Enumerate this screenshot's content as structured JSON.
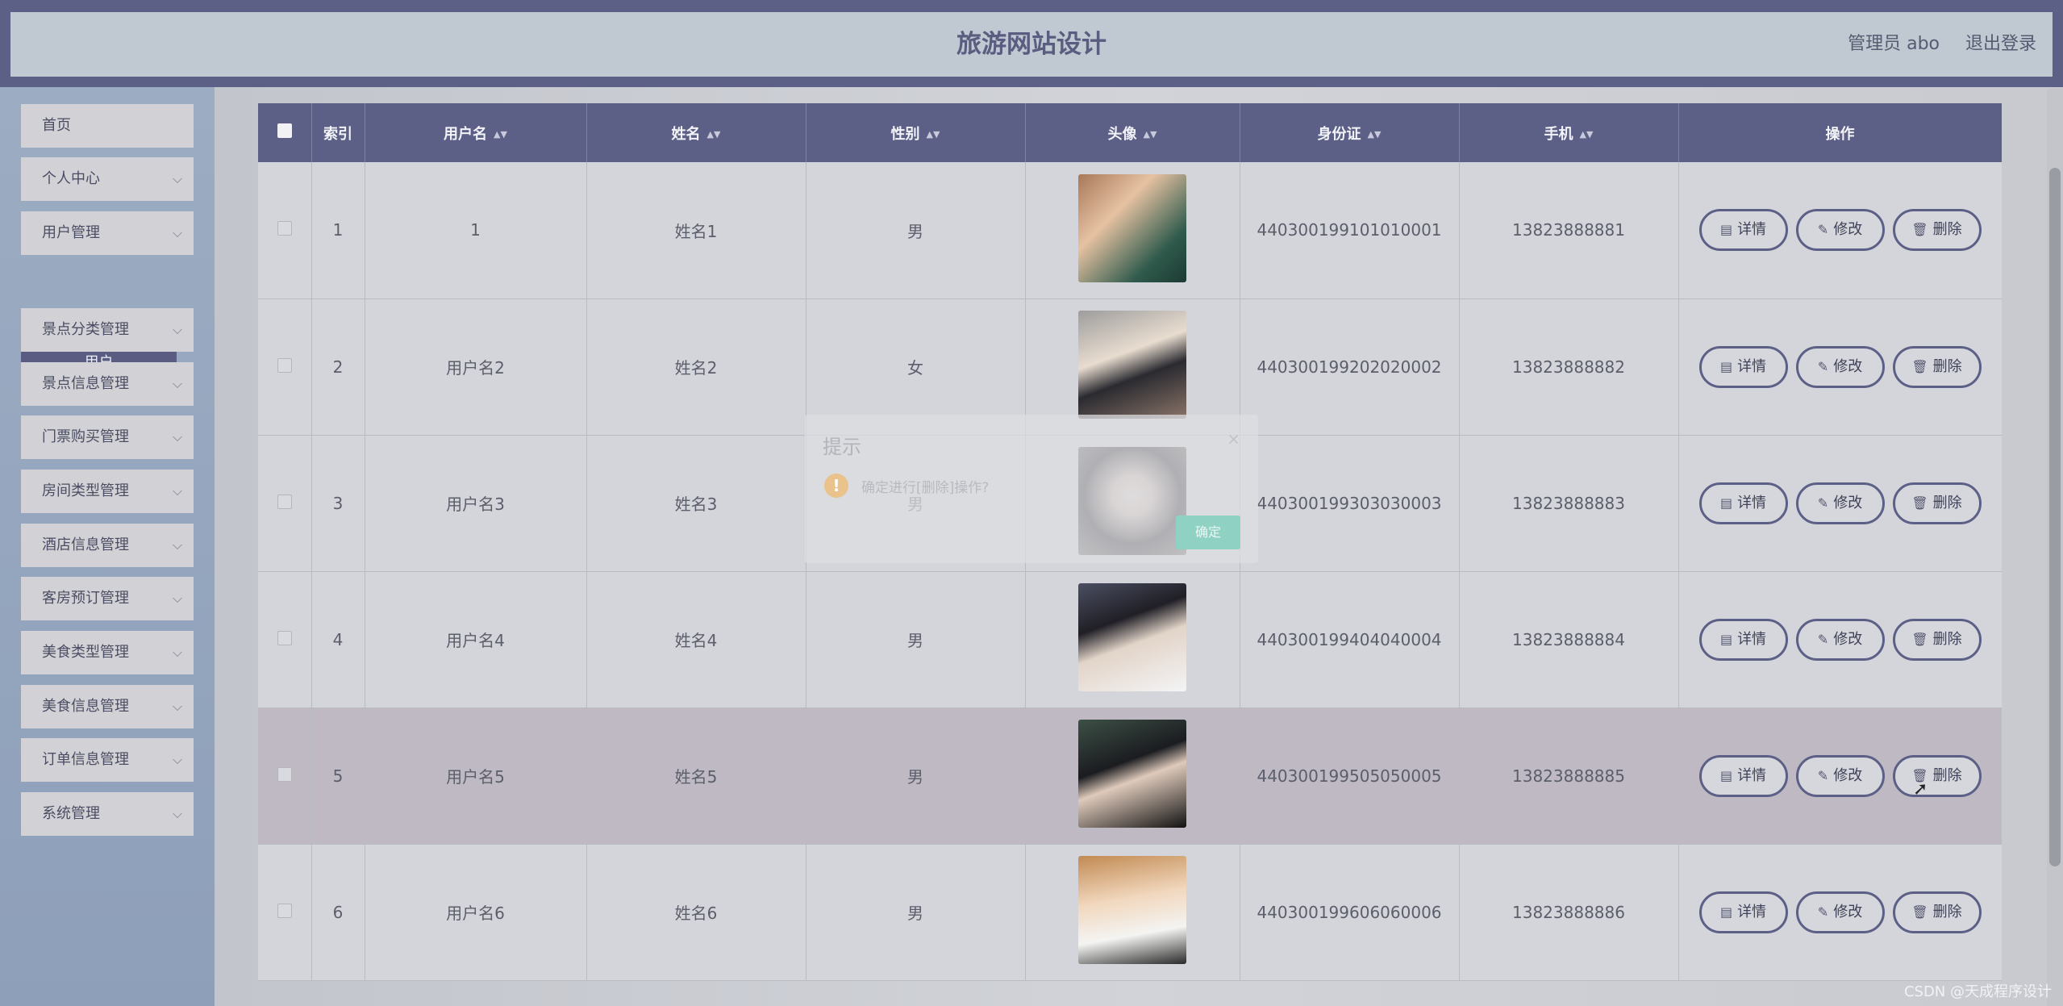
{
  "header": {
    "title": "旅游网站设计",
    "user": "管理员 abo",
    "logout": "退出登录"
  },
  "sidebar": {
    "items": [
      {
        "label": "首页",
        "has_arrow": false
      },
      {
        "label": "个人中心",
        "has_arrow": true
      },
      {
        "label": "用户管理",
        "has_arrow": true
      },
      {
        "label": "景点分类管理",
        "has_arrow": true
      },
      {
        "label": "景点信息管理",
        "has_arrow": true
      },
      {
        "label": "门票购买管理",
        "has_arrow": true
      },
      {
        "label": "房间类型管理",
        "has_arrow": true
      },
      {
        "label": "酒店信息管理",
        "has_arrow": true
      },
      {
        "label": "客房预订管理",
        "has_arrow": true
      },
      {
        "label": "美食类型管理",
        "has_arrow": true
      },
      {
        "label": "美食信息管理",
        "has_arrow": true
      },
      {
        "label": "订单信息管理",
        "has_arrow": true
      },
      {
        "label": "系统管理",
        "has_arrow": true
      }
    ],
    "active_sub": "用户"
  },
  "table": {
    "columns": [
      "索引",
      "用户名",
      "姓名",
      "性别",
      "头像",
      "身份证",
      "手机",
      "操作"
    ],
    "rows": [
      {
        "index": "1",
        "username": "1",
        "name": "姓名1",
        "gender": "男",
        "id_card": "440300199101010001",
        "phone": "13823888881"
      },
      {
        "index": "2",
        "username": "用户名2",
        "name": "姓名2",
        "gender": "女",
        "id_card": "440300199202020002",
        "phone": "13823888882"
      },
      {
        "index": "3",
        "username": "用户名3",
        "name": "姓名3",
        "gender": "男",
        "id_card": "440300199303030003",
        "phone": "13823888883"
      },
      {
        "index": "4",
        "username": "用户名4",
        "name": "姓名4",
        "gender": "男",
        "id_card": "440300199404040004",
        "phone": "13823888884"
      },
      {
        "index": "5",
        "username": "用户名5",
        "name": "姓名5",
        "gender": "男",
        "id_card": "440300199505050005",
        "phone": "13823888885"
      },
      {
        "index": "6",
        "username": "用户名6",
        "name": "姓名6",
        "gender": "男",
        "id_card": "440300199606060006",
        "phone": "13823888886"
      }
    ],
    "actions": {
      "detail": "详情",
      "edit": "修改",
      "delete": "删除"
    }
  },
  "dialog": {
    "title": "提示",
    "message": "确定进行[删除]操作?",
    "confirm": "确定",
    "close": "×"
  },
  "watermark": "CSDN @天成程序设计",
  "colors": {
    "primary": "#5c5f86",
    "header_bg": "#c0c8d2",
    "sidebar_bg": "#9cacc2",
    "confirm": "#8fd1c3",
    "warning": "#e9c28c"
  }
}
